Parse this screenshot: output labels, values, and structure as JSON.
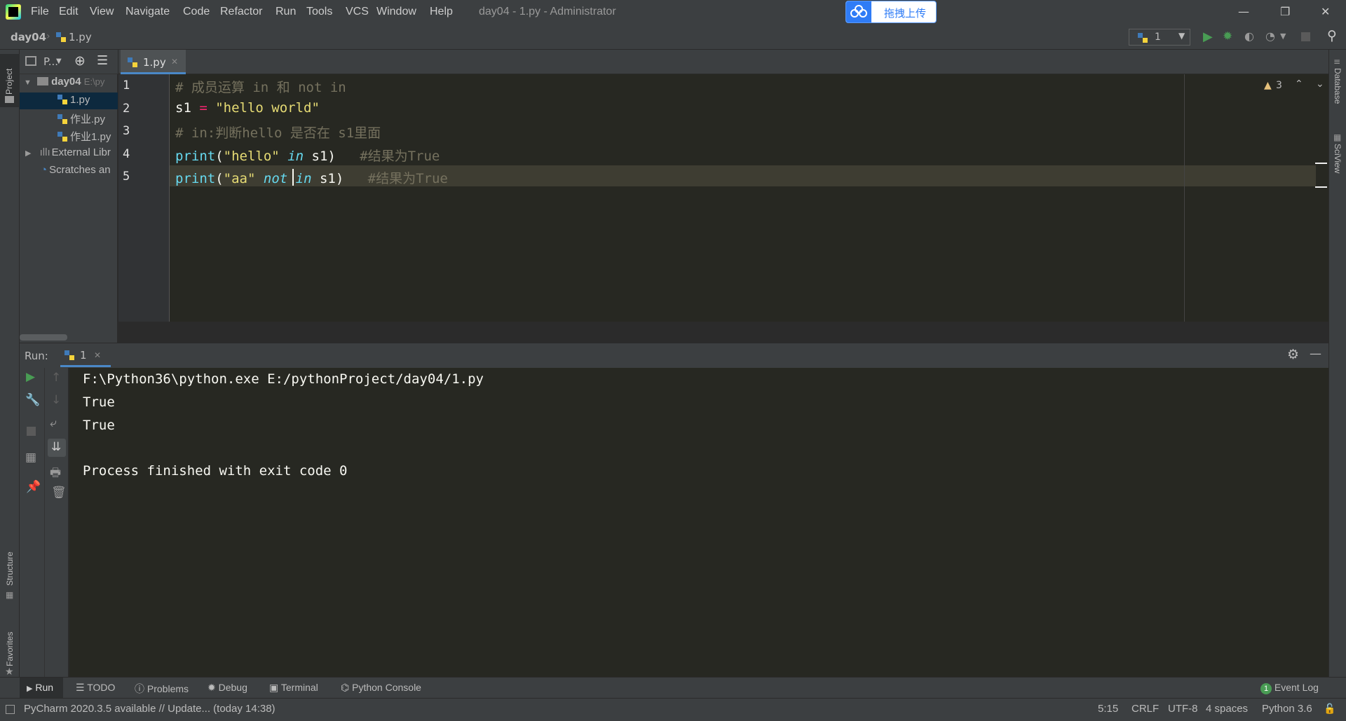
{
  "menu": {
    "items": [
      "File",
      "Edit",
      "View",
      "Navigate",
      "Code",
      "Refactor",
      "Run",
      "Tools",
      "VCS",
      "Window",
      "Help"
    ],
    "window_title": "day04 - 1.py - Administrator",
    "upload_label": "拖拽上传"
  },
  "navbar": {
    "breadcrumb_project": "day04",
    "breadcrumb_file": "1.py",
    "run_config": "1"
  },
  "project_panel": {
    "title": "P...",
    "tree": [
      {
        "label": "day04",
        "path": "E:\\py"
      },
      {
        "label": "1.py"
      },
      {
        "label": "作业.py"
      },
      {
        "label": "作业1.py"
      },
      {
        "label": "External Libr"
      },
      {
        "label": "Scratches an"
      }
    ]
  },
  "sidebars": {
    "left_top": "Project",
    "left_structure": "Structure",
    "left_favorites": "Favorites",
    "right_database": "Database",
    "right_sciview": "SciView"
  },
  "editor": {
    "tab_label": "1.py",
    "warning_count": "3",
    "line_numbers": [
      "1",
      "2",
      "3",
      "4",
      "5"
    ],
    "lines": [
      [
        {
          "t": "# 成员运算 in 和 not in",
          "c": "cm"
        }
      ],
      [
        {
          "t": "s1",
          "c": "pl"
        },
        {
          "t": " = ",
          "c": "op"
        },
        {
          "t": "\"hello world\"",
          "c": "st"
        }
      ],
      [
        {
          "t": "# in:判断hello 是否在 s1里面",
          "c": "cm"
        }
      ],
      [
        {
          "t": "print",
          "c": "fn"
        },
        {
          "t": "(",
          "c": "pl"
        },
        {
          "t": "\"hello\"",
          "c": "st"
        },
        {
          "t": " ",
          "c": "pl"
        },
        {
          "t": "in",
          "c": "kw"
        },
        {
          "t": " s1)   ",
          "c": "pl"
        },
        {
          "t": "#结果为True",
          "c": "cm"
        }
      ],
      [
        {
          "t": "print",
          "c": "fn"
        },
        {
          "t": "(",
          "c": "pl"
        },
        {
          "t": "\"aa\"",
          "c": "st"
        },
        {
          "t": " ",
          "c": "pl"
        },
        {
          "t": "not",
          "c": "kw"
        },
        {
          "t": " ",
          "c": "pl"
        },
        {
          "t": "in",
          "c": "kw"
        },
        {
          "t": " s1)   ",
          "c": "pl"
        },
        {
          "t": "#结果为True",
          "c": "cm"
        }
      ]
    ]
  },
  "run_panel": {
    "label": "Run:",
    "tab_label": "1",
    "console": [
      "F:\\Python36\\python.exe E:/pythonProject/day04/1.py",
      "True",
      "True",
      "",
      "Process finished with exit code 0"
    ]
  },
  "bottom_tabs": [
    "Run",
    "TODO",
    "Problems",
    "Debug",
    "Terminal",
    "Python Console"
  ],
  "event_log": {
    "count": "1",
    "label": "Event Log"
  },
  "status": {
    "message": "PyCharm 2020.3.5 available // Update... (today 14:38)",
    "position": "5:15",
    "line_sep": "CRLF",
    "encoding": "UTF-8",
    "indent": "4 spaces",
    "interpreter": "Python 3.6"
  },
  "colors": {
    "editor_bg": "#272822",
    "panel_bg": "#3c3f41",
    "accent": "#4a88c7",
    "run_green": "#499c54"
  }
}
